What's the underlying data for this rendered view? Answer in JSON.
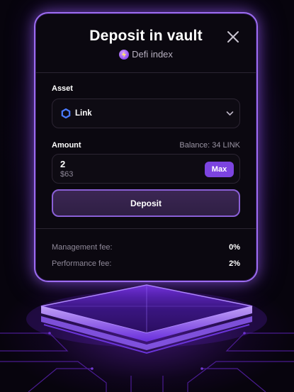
{
  "dialog": {
    "title": "Deposit in vault",
    "subtitle": "Defi index",
    "close_icon": "close-icon"
  },
  "asset": {
    "label": "Asset",
    "selected": "Link",
    "icon": "chainlink-hexagon-icon"
  },
  "amount": {
    "label": "Amount",
    "balance": "Balance: 34 LINK",
    "value": "2",
    "usd_value": "$63",
    "max_label": "Max"
  },
  "deposit_button": "Deposit",
  "fees": [
    {
      "label": "Management fee:",
      "value": "0%"
    },
    {
      "label": "Performance fee:",
      "value": "2%"
    }
  ],
  "colors": {
    "accent": "#7c44e0",
    "card_border": "#9c6cf0",
    "background": "#07040d"
  }
}
